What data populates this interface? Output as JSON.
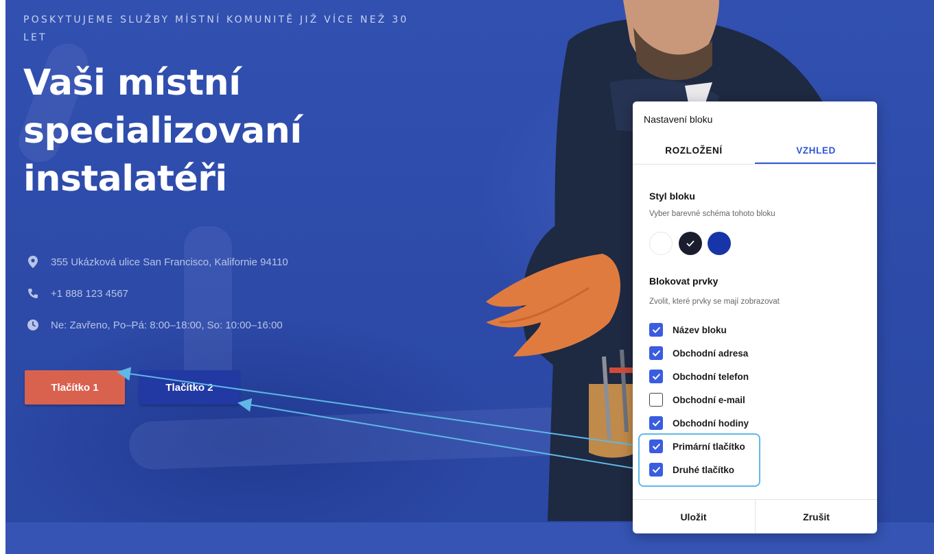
{
  "hero": {
    "eyebrow": "POSKYTUJEME SLUŽBY MÍSTNÍ KOMUNITĚ JIŽ VÍCE NEŽ 30 LET",
    "headline": "Vaši místní specializovaní instalatéři",
    "info": [
      {
        "icon": "location-pin-icon",
        "text": "355 Ukázková ulice San Francisco, Kalifornie 94110"
      },
      {
        "icon": "phone-icon",
        "text": "+1 888 123 4567"
      },
      {
        "icon": "clock-icon",
        "text": "Ne: Zavřeno, Po–Pá: 8:00–18:00, So: 10:00–16:00"
      }
    ],
    "button1": "Tlačítko 1",
    "button2": "Tlačítko 2"
  },
  "panel": {
    "title": "Nastavení bloku",
    "tabs": [
      {
        "label": "ROZLOŽENÍ",
        "active": false
      },
      {
        "label": "VZHLED",
        "active": true
      }
    ],
    "style_section": {
      "title": "Styl bloku",
      "subtitle": "Vyber barevné schéma tohoto bloku",
      "swatches": [
        {
          "color": "#ffffff",
          "selected": false
        },
        {
          "color": "#1a1d2e",
          "selected": true
        },
        {
          "color": "#1735a8",
          "selected": false
        }
      ]
    },
    "elements_section": {
      "title": "Blokovat prvky",
      "subtitle": "Zvolit, které prvky se mají zobrazovat",
      "items": [
        {
          "label": "Název bloku",
          "checked": true
        },
        {
          "label": "Obchodní adresa",
          "checked": true
        },
        {
          "label": "Obchodní telefon",
          "checked": true
        },
        {
          "label": "Obchodní e-mail",
          "checked": false
        },
        {
          "label": "Obchodní hodiny",
          "checked": true
        },
        {
          "label": "Primární tlačítko",
          "checked": true
        },
        {
          "label": "Druhé tlačítko",
          "checked": true
        }
      ]
    },
    "save_label": "Uložit",
    "cancel_label": "Zrušit"
  },
  "colors": {
    "accent": "#2f55d4",
    "checkbox": "#3a5ce0",
    "primary_button": "#d9624f",
    "secondary_button": "#2238a2",
    "hero_bg": "#2d4aa8",
    "annotation": "#5fb8e6"
  }
}
